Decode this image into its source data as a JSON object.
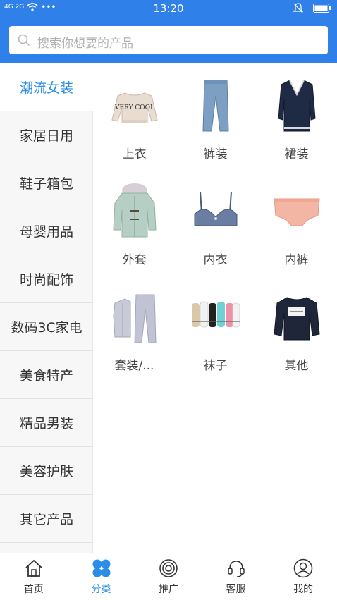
{
  "status_bar": {
    "left": "4G 2G",
    "time": "13:20"
  },
  "search": {
    "placeholder": "搜索你想要的产品"
  },
  "sidebar": {
    "items": [
      {
        "label": "潮流女装",
        "active": true
      },
      {
        "label": "家居日用"
      },
      {
        "label": "鞋子箱包"
      },
      {
        "label": "母婴用品"
      },
      {
        "label": "时尚配饰"
      },
      {
        "label": "数码3C家电"
      },
      {
        "label": "美食特产"
      },
      {
        "label": "精品男装"
      },
      {
        "label": "美容护肤"
      },
      {
        "label": "其它产品"
      }
    ]
  },
  "categories": [
    {
      "label": "上衣",
      "icon": "sweater-image",
      "print": "VERY COOL"
    },
    {
      "label": "裤装",
      "icon": "jeans-image"
    },
    {
      "label": "裙装",
      "icon": "dress-image"
    },
    {
      "label": "外套",
      "icon": "coat-image"
    },
    {
      "label": "内衣",
      "icon": "bra-image"
    },
    {
      "label": "内裤",
      "icon": "underwear-image"
    },
    {
      "label": "套装/...",
      "icon": "tracksuit-image"
    },
    {
      "label": "袜子",
      "icon": "socks-image"
    },
    {
      "label": "其他",
      "icon": "sweatshirt-image"
    }
  ],
  "tabbar": {
    "items": [
      {
        "label": "首页",
        "icon": "home-icon"
      },
      {
        "label": "分类",
        "icon": "category-icon",
        "active": true
      },
      {
        "label": "推广",
        "icon": "promote-icon"
      },
      {
        "label": "客服",
        "icon": "service-icon"
      },
      {
        "label": "我的",
        "icon": "user-icon"
      }
    ]
  },
  "colors": {
    "primary": "#2f80e8",
    "active_text": "#2b8ee6"
  }
}
